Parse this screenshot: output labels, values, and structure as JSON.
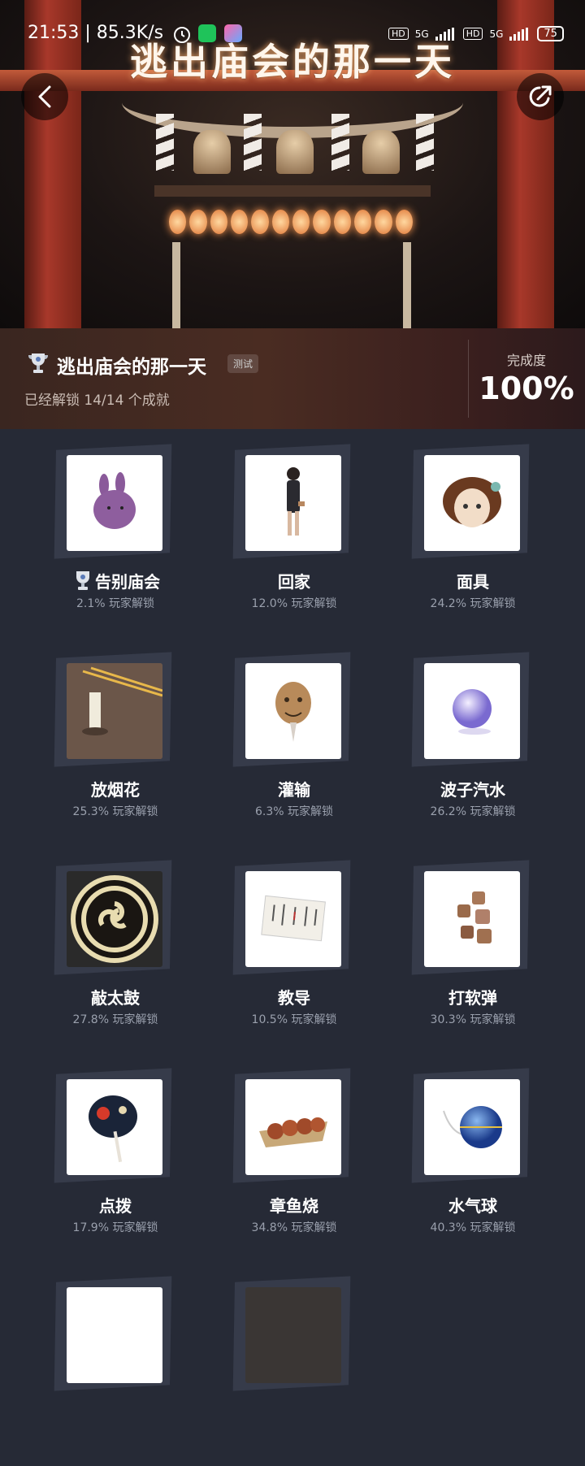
{
  "status_bar": {
    "time": "21:53 | 85.3K/s",
    "net1": "5G",
    "net2": "5G",
    "hd": "HD",
    "battery": "75"
  },
  "banner": {
    "title": "逃出庙会的那一天"
  },
  "game": {
    "name": "逃出庙会的那一天",
    "tag": "测试",
    "unlocked_text": "已经解锁 14/14 个成就",
    "completion_label": "完成度",
    "completion_value": "100%"
  },
  "achievements": [
    {
      "title": "告别庙会",
      "pct": "2.1% 玩家解锁",
      "icon": "purple-rabbit-icon",
      "rare": true
    },
    {
      "title": "回家",
      "pct": "12.0% 玩家解锁",
      "icon": "girl-walking-icon"
    },
    {
      "title": "面具",
      "pct": "24.2% 玩家解锁",
      "icon": "doll-mask-icon"
    },
    {
      "title": "放烟花",
      "pct": "25.3% 玩家解锁",
      "icon": "candle-sparkler-icon"
    },
    {
      "title": "灌输",
      "pct": "6.3% 玩家解锁",
      "icon": "old-man-mask-icon"
    },
    {
      "title": "波子汽水",
      "pct": "26.2% 玩家解锁",
      "icon": "glass-marble-icon"
    },
    {
      "title": "敲太鼓",
      "pct": "27.8% 玩家解锁",
      "icon": "taiko-drum-icon"
    },
    {
      "title": "教导",
      "pct": "10.5% 玩家解锁",
      "icon": "note-paper-icon"
    },
    {
      "title": "打软弹",
      "pct": "30.3% 玩家解锁",
      "icon": "cork-pellets-icon"
    },
    {
      "title": "点拨",
      "pct": "17.9% 玩家解锁",
      "icon": "uchiwa-fan-icon"
    },
    {
      "title": "章鱼烧",
      "pct": "34.8% 玩家解锁",
      "icon": "takoyaki-icon"
    },
    {
      "title": "水气球",
      "pct": "40.3% 玩家解锁",
      "icon": "water-balloon-icon"
    }
  ]
}
